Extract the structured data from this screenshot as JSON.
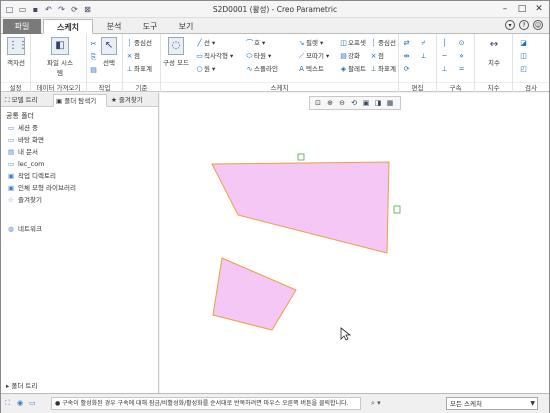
{
  "window": {
    "title": "S2D0001 (활성) - Creo Parametric"
  },
  "qat": [
    "D",
    "O",
    "S",
    "U",
    "R",
    "W",
    "X"
  ],
  "tabs": {
    "file": "파일",
    "sketch": "스케치",
    "analysis": "분석",
    "tools": "도구",
    "view": "보기"
  },
  "ribbon": {
    "setup": {
      "label": "설정",
      "button": "객자선"
    },
    "getdata": {
      "label": "데이터 가져오기",
      "button": "파일 시스템"
    },
    "operations": {
      "label": "작업",
      "select": "선택"
    },
    "datum": {
      "label": "기준",
      "items": [
        "중심선",
        "점",
        "좌표계"
      ]
    },
    "sketching": {
      "label": "스케치",
      "construction": "구성 모드",
      "items": [
        "선",
        "직사각형",
        "원",
        "호",
        "타원",
        "스플라인",
        "필렛",
        "모따기",
        "텍스트",
        "오프셋",
        "강화",
        "팔레트",
        "중심선",
        "점",
        "좌표계"
      ]
    },
    "editing": {
      "label": "편집"
    },
    "constrain": {
      "label": "구속"
    },
    "dimension": {
      "label": "치수",
      "button": "치수"
    },
    "inspect": {
      "label": "검사"
    }
  },
  "left_panel": {
    "tabs": [
      "모델 트리",
      "폴더 탐색기",
      "즐겨찾기"
    ],
    "heading": "공통 폴더",
    "items": [
      "세션 중",
      "바탕 화면",
      "내 문서",
      "lec_com",
      "작업 디렉토리",
      "인체 모형 라이브러리",
      "즐겨찾기"
    ],
    "network": "네트워크",
    "footer": "폴더 트리"
  },
  "canvas": {
    "fill_color": "#F5C7F5",
    "edge_color": "#E8A040"
  },
  "status": {
    "message": "구속이 활성화된 경우 구속에 대해 잠금/비활성화/활성화를 순서대로 반복하려면 마우스 오른쪽 버튼을 클릭합니다.",
    "filter": "모든 스케처"
  }
}
